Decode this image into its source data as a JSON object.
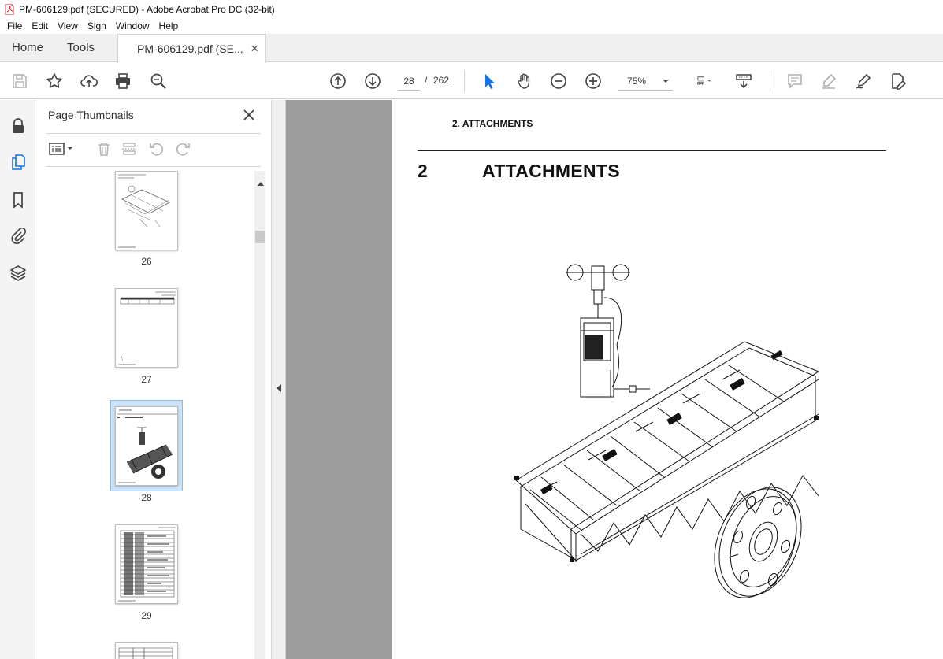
{
  "window": {
    "title": "PM-606129.pdf (SECURED) - Adobe Acrobat Pro DC (32-bit)"
  },
  "menu": [
    "File",
    "Edit",
    "View",
    "Sign",
    "Window",
    "Help"
  ],
  "tabs": {
    "home": "Home",
    "tools": "Tools",
    "document": "PM-606129.pdf (SE..."
  },
  "toolbar": {
    "current_page": "28",
    "page_sep": "/",
    "total_pages": "262",
    "zoom": "75%"
  },
  "thumbnails_panel": {
    "title": "Page Thumbnails",
    "pages": [
      {
        "label": "26"
      },
      {
        "label": "27"
      },
      {
        "label": "28",
        "selected": true
      },
      {
        "label": "29"
      }
    ]
  },
  "document": {
    "running_header": "2. ATTACHMENTS",
    "section_number": "2",
    "section_title": "ATTACHMENTS"
  },
  "colors": {
    "selection": "#cde3f7",
    "accent_blue": "#1473e6",
    "canvas_gray": "#9d9d9d",
    "pdf_red": "#d7282f"
  }
}
